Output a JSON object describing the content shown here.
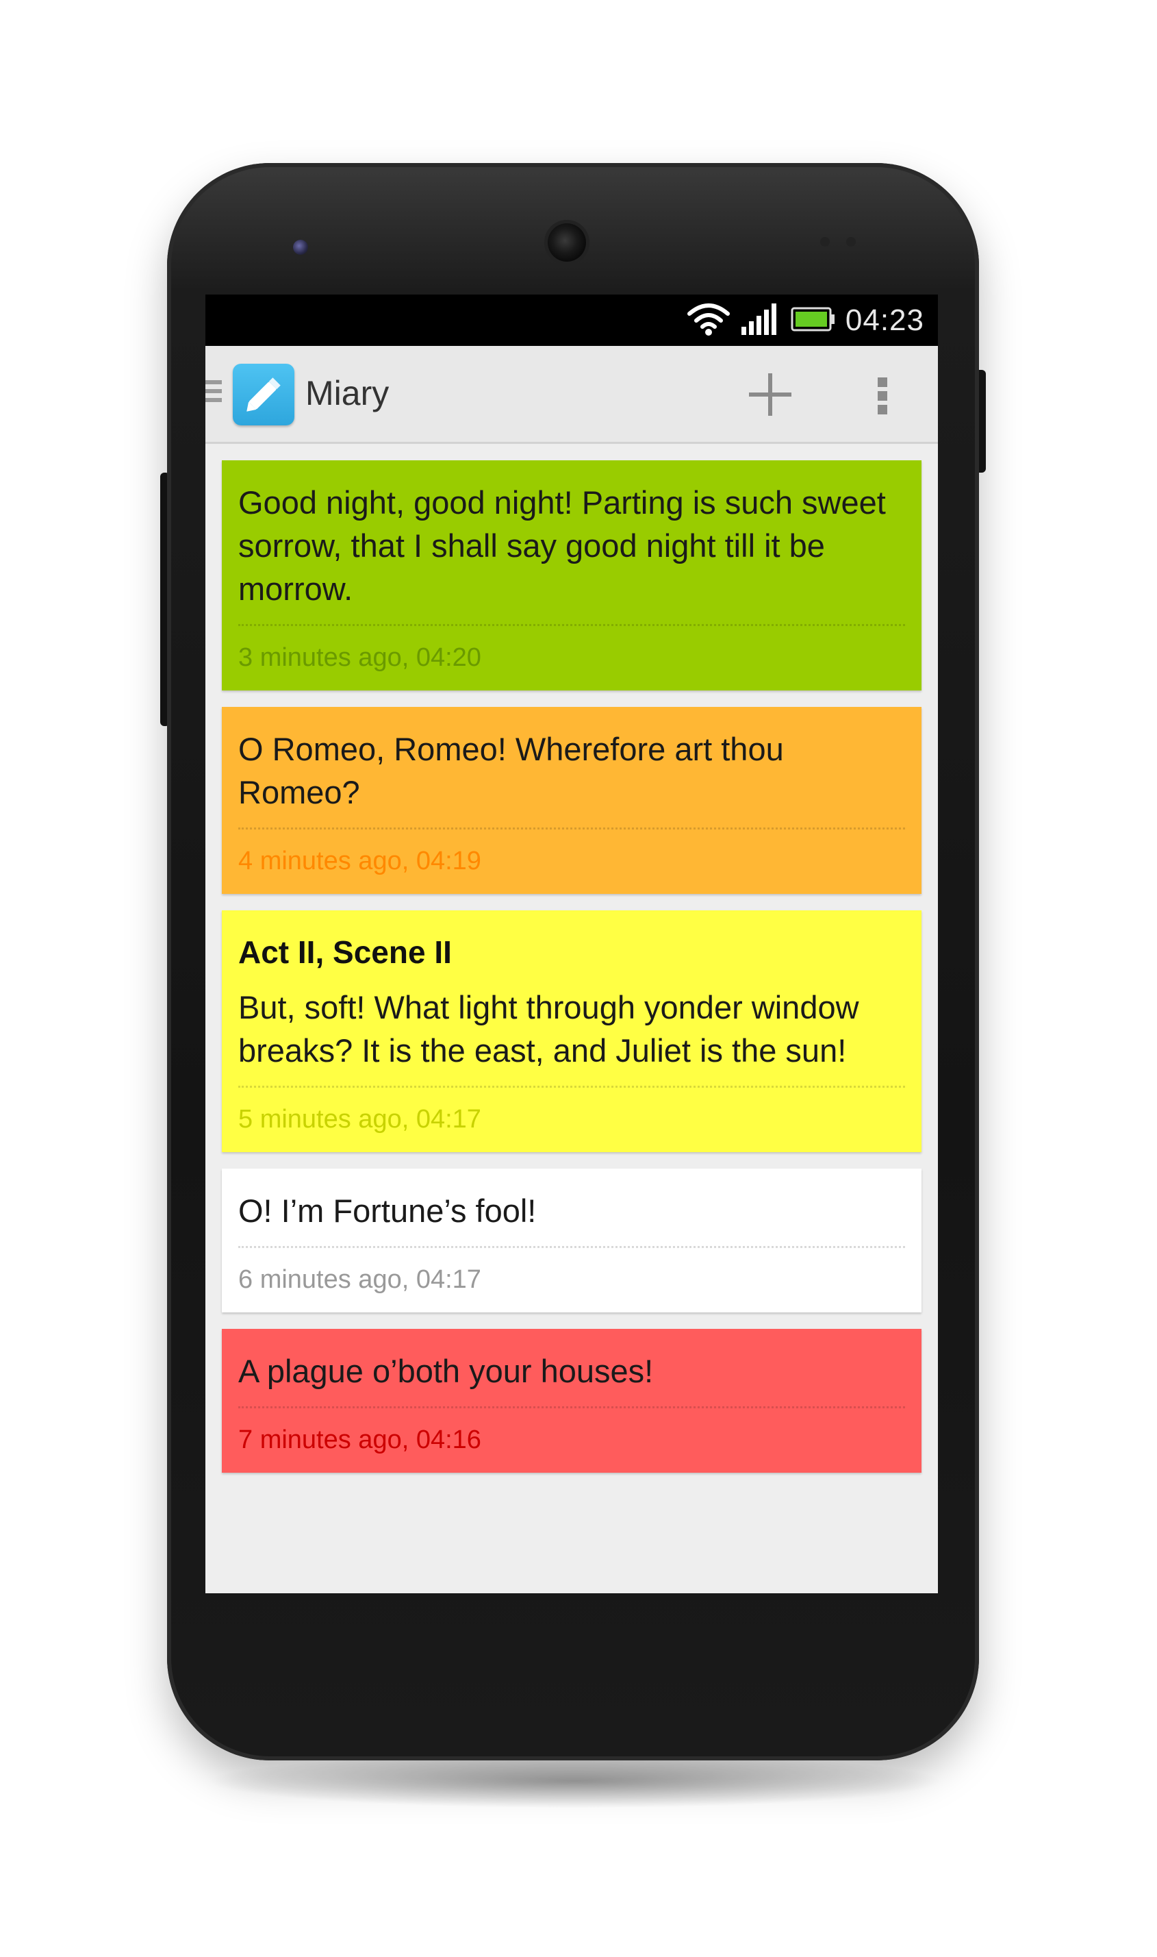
{
  "status_bar": {
    "time": "04:23",
    "icons": [
      "wifi-icon",
      "cell-signal-icon",
      "battery-icon"
    ]
  },
  "action_bar": {
    "app_title": "Miary",
    "icons": [
      "drawer-icon",
      "pencil-icon",
      "add-icon",
      "overflow-menu-icon"
    ]
  },
  "notes": [
    {
      "title": "",
      "text": "Good night, good night! Parting is such sweet sorrow, that I shall say good night till it be morrow.",
      "time": "3 minutes ago, 04:20",
      "bg_color": "#99cc00",
      "time_color": "#6a9a00"
    },
    {
      "title": "",
      "text": "O Romeo, Romeo! Wherefore art thou Romeo?",
      "time": "4 minutes ago, 04:19",
      "bg_color": "#ffb734",
      "time_color": "#ff8800"
    },
    {
      "title": "Act II, Scene II",
      "text": "But, soft! What light through yonder window breaks? It is the east, and Juliet is the sun!",
      "time": "5 minutes ago, 04:17",
      "bg_color": "#ffff44",
      "time_color": "#c8d200"
    },
    {
      "title": "",
      "text": "O! I’m Fortune’s fool!",
      "time": "6 minutes ago, 04:17",
      "bg_color": "#ffffff",
      "time_color": "#999999"
    },
    {
      "title": "",
      "text": "A plague o’both your houses!",
      "time": "7 minutes ago, 04:16",
      "bg_color": "#ff5c5c",
      "time_color": "#cc0000"
    }
  ]
}
